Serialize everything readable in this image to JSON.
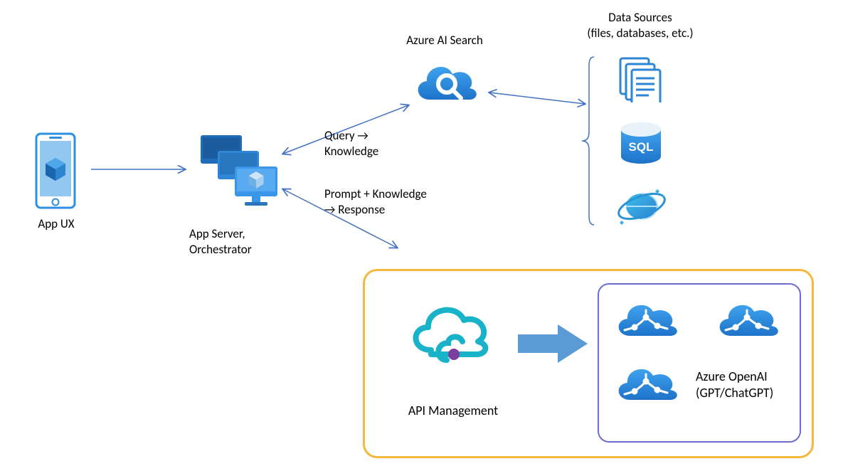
{
  "labels": {
    "app_ux": "App UX",
    "app_server": "App Server,\nOrchestrator",
    "azure_ai_search": "Azure AI Search",
    "data_sources": "Data Sources\n(files, databases, etc.)",
    "query_knowledge": "Query →\nKnowledge",
    "prompt_knowledge": "Prompt + Knowledge\n→ Response",
    "api_management": "API Management",
    "azure_openai": "Azure OpenAI\n(GPT/ChatGPT)",
    "sql_badge": "SQL"
  },
  "colors": {
    "azure_blue": "#1F8EE5",
    "azure_blue_dark": "#2072C4",
    "azure_light": "#50ADF0",
    "arrow_blue": "#4472C4",
    "thick_arrow": "#5B9BD5",
    "yellow": "#F5B83D",
    "purple": "#6D6DD1",
    "cosmos_start": "#59B4D9",
    "cosmos_end": "#3999C6"
  },
  "nodes": [
    {
      "id": "app_ux",
      "type": "phone",
      "label_key": "app_ux"
    },
    {
      "id": "app_server",
      "type": "monitors",
      "label_key": "app_server"
    },
    {
      "id": "azure_ai_search",
      "type": "cloud_search",
      "label_key": "azure_ai_search"
    },
    {
      "id": "files",
      "type": "files_icon"
    },
    {
      "id": "sql",
      "type": "sql_db"
    },
    {
      "id": "cosmos",
      "type": "cosmos_db"
    },
    {
      "id": "api_mgmt",
      "type": "api_cloud",
      "label_key": "api_management"
    },
    {
      "id": "openai_group",
      "type": "ai_cloud_group",
      "label_key": "azure_openai"
    }
  ],
  "edges": [
    {
      "from": "app_ux",
      "to": "app_server",
      "style": "arrow",
      "heads": "end"
    },
    {
      "from": "app_server",
      "to": "azure_ai_search",
      "style": "arrow",
      "heads": "both",
      "label_key": "query_knowledge"
    },
    {
      "from": "app_server",
      "to": "api_mgmt_box",
      "style": "arrow",
      "heads": "both",
      "label_key": "prompt_knowledge"
    },
    {
      "from": "azure_ai_search",
      "to": "data_sources_group",
      "style": "arrow",
      "heads": "both"
    },
    {
      "from": "api_mgmt",
      "to": "openai_group",
      "style": "thick_arrow",
      "heads": "end"
    }
  ]
}
